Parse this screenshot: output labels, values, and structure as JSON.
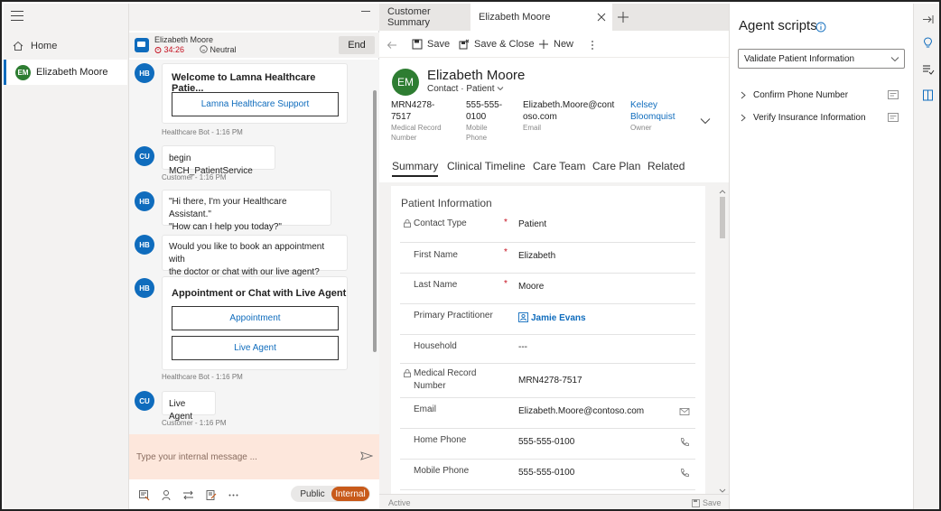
{
  "nav": {
    "home_label": "Home",
    "session": {
      "initials": "EM",
      "name": "Elizabeth Moore"
    }
  },
  "conversation": {
    "customer_name": "Elizabeth Moore",
    "timer": "34:26",
    "sentiment": "Neutral",
    "end_label": "End",
    "messages": [
      {
        "avatar": "HB",
        "type": "card",
        "title": "Welcome to Lamna Healthcare Patie...",
        "buttons": [
          "Lamna Healthcare Support"
        ],
        "meta": "Healthcare Bot - 1:16 PM"
      },
      {
        "avatar": "CU",
        "type": "text",
        "text": "begin MCH_PatientService",
        "meta": "Customer - 1:16 PM"
      },
      {
        "avatar": "HB",
        "type": "text",
        "lines": [
          "\"Hi there, I'm your Healthcare Assistant.\"",
          "\"How can I help you today?\""
        ]
      },
      {
        "avatar": "HB",
        "type": "text",
        "lines": [
          "Would you like to book an appointment with",
          "the doctor or chat with our live agent?"
        ]
      },
      {
        "avatar": "HB",
        "type": "card",
        "title": "Appointment or Chat with Live Agent",
        "buttons": [
          "Appointment",
          "Live Agent"
        ],
        "meta": "Healthcare Bot - 1:16 PM"
      },
      {
        "avatar": "CU",
        "type": "text",
        "text": "Live Agent",
        "meta": "Customer - 1:16 PM"
      }
    ],
    "compose_placeholder": "Type your internal message ...",
    "toggle": {
      "public": "Public",
      "internal": "Internal",
      "selected": "internal"
    }
  },
  "record": {
    "tabs": [
      "Customer Summary",
      "Elizabeth Moore"
    ],
    "commands": {
      "save": "Save",
      "save_close": "Save & Close",
      "new": "New"
    },
    "initials": "EM",
    "name": "Elizabeth Moore",
    "entity": "Contact",
    "form": "Patient",
    "header_fields": [
      {
        "lines": [
          "MRN4278-",
          "7517"
        ],
        "label_lines": [
          "Medical Record",
          "Number"
        ]
      },
      {
        "lines": [
          "555-555-",
          "0100"
        ],
        "label_lines": [
          "Mobile",
          "Phone"
        ]
      },
      {
        "lines": [
          "Elizabeth.Moore@cont",
          "oso.com"
        ],
        "label_lines": [
          "Email"
        ]
      },
      {
        "lines": [
          "Kelsey",
          "Bloomquist"
        ],
        "label_lines": [
          "Owner"
        ]
      }
    ],
    "form_tabs": [
      "Summary",
      "Clinical Timeline",
      "Care Team",
      "Care Plan",
      "Related"
    ],
    "section_title": "Patient Information",
    "fields": [
      {
        "label": "Contact Type",
        "value": "Patient",
        "locked": true,
        "required": true
      },
      {
        "label": "First Name",
        "value": "Elizabeth",
        "required": true
      },
      {
        "label": "Last Name",
        "value": "Moore",
        "required": true
      },
      {
        "label": "Primary Practitioner",
        "value": "Jamie Evans",
        "link": true
      },
      {
        "label": "Household",
        "value": "---"
      },
      {
        "label_lines": [
          "Medical Record",
          "Number"
        ],
        "value": "MRN4278-7517",
        "locked": true
      },
      {
        "label": "Email",
        "value": "Elizabeth.Moore@contoso.com",
        "icon": "email-icon"
      },
      {
        "label": "Home Phone",
        "value": "555-555-0100",
        "icon": "phone-icon"
      },
      {
        "label": "Mobile Phone",
        "value": "555-555-0100",
        "icon": "phone-icon"
      }
    ],
    "status": "Active",
    "status_save": "Save"
  },
  "scripts": {
    "title": "Agent scripts",
    "selected": "Validate Patient Information",
    "items": [
      "Confirm Phone Number",
      "Verify Insurance Information"
    ]
  },
  "colors": {
    "accent": "#0f6cbd",
    "avatar_green": "#2e7d32",
    "internal_toggle": "#c85a1a",
    "compose_bg": "#fde7dc",
    "timer_red": "#c50f1f"
  }
}
